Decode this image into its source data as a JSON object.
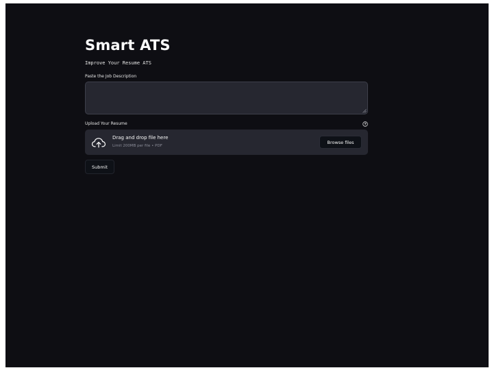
{
  "header": {
    "title": "Smart ATS",
    "subtitle": "Improve Your Resume ATS"
  },
  "job_description": {
    "label": "Paste the Job Description",
    "value": "",
    "placeholder": ""
  },
  "resume_upload": {
    "label": "Upload Your Resume",
    "help_icon": "question-circle-icon",
    "dropzone_icon": "cloud-upload-icon",
    "dropzone_title": "Drag and drop file here",
    "dropzone_limit": "Limit 200MB per file • PDF",
    "browse_label": "Browse files"
  },
  "actions": {
    "submit_label": "Submit"
  },
  "colors": {
    "background": "#0e0e13",
    "input_background": "#262730",
    "button_background": "#0e1117",
    "text": "#fafafa",
    "muted_text": "#8b8d98"
  }
}
